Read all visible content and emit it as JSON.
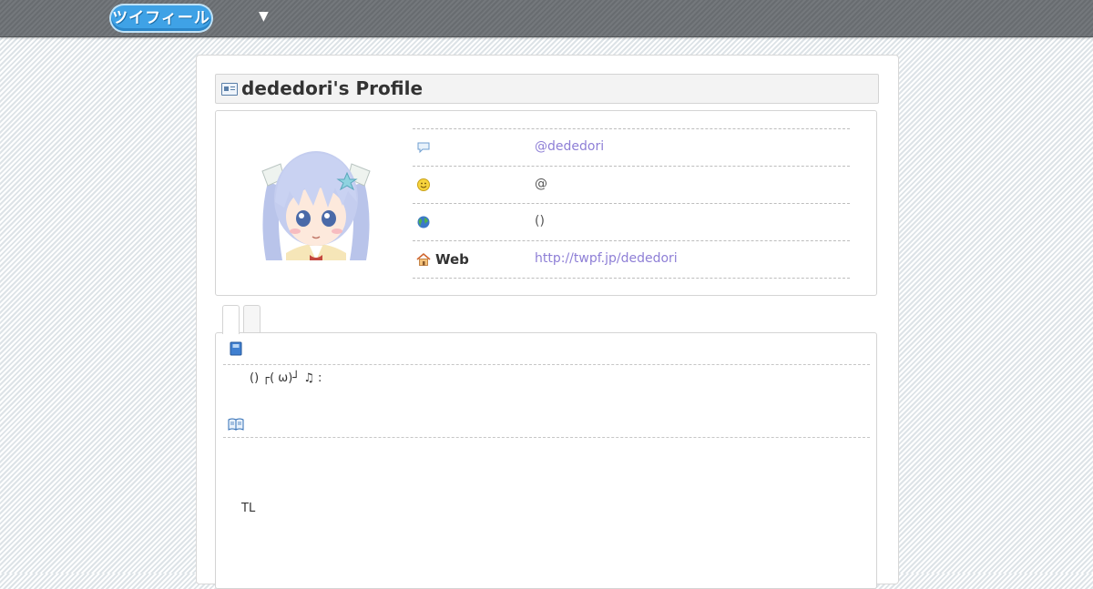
{
  "header": {
    "logo_text": "ツイフィール",
    "menu_toggle": "▼"
  },
  "profile": {
    "title": "dededori's Profile",
    "rows": [
      {
        "icon": "speech-bubble-icon",
        "label": "",
        "value": "@dededori",
        "is_link": true
      },
      {
        "icon": "smiley-icon",
        "label": "",
        "value": "@",
        "is_link": false
      },
      {
        "icon": "globe-icon",
        "label": "",
        "value": "()",
        "is_link": false
      },
      {
        "icon": "house-icon",
        "label": "Web",
        "value": "http://twpf.jp/dededori",
        "is_link": true
      }
    ]
  },
  "tabs": [
    {
      "label": ""
    },
    {
      "label": ""
    }
  ],
  "content": {
    "bio_icon": "book-blue-icon",
    "bio_text": "() ┌( ω)┘ ♫ :",
    "detail_icon": "open-book-icon",
    "timeline_label": "TL"
  },
  "colors": {
    "link": "#8e7fd6",
    "logo_blue": "#3fa2e6",
    "topbar": "#6e7276"
  }
}
